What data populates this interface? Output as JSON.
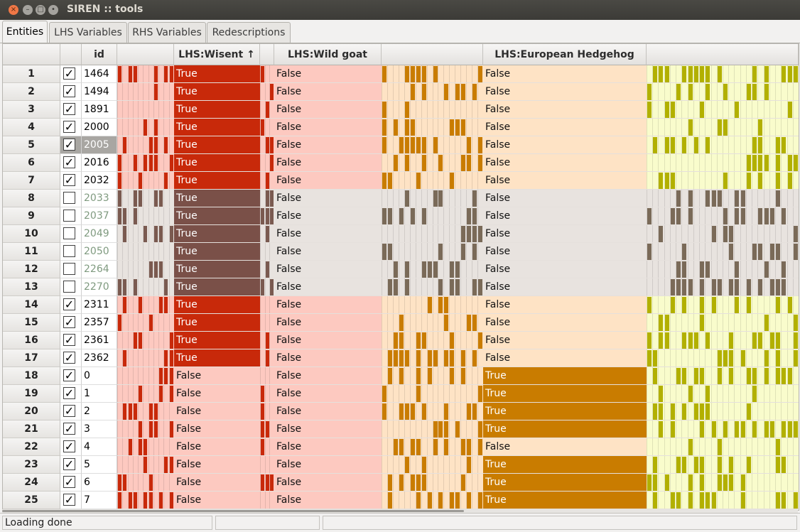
{
  "window": {
    "title": "SIREN :: tools"
  },
  "tabs": [
    {
      "label": "Entities",
      "active": true
    },
    {
      "label": "LHS Variables",
      "active": false
    },
    {
      "label": "RHS Variables",
      "active": false
    },
    {
      "label": "Redescriptions",
      "active": false
    }
  ],
  "grid": {
    "headers": {
      "id": "id",
      "col1": "LHS:Wisent ↑",
      "col2": "LHS:Wild goat",
      "col3": "LHS:European Hedgehog"
    },
    "rows": [
      {
        "n": "1",
        "checked": true,
        "id": "1464",
        "enabled": true,
        "c1": "True",
        "c2": "False",
        "c3": "False"
      },
      {
        "n": "2",
        "checked": true,
        "id": "1494",
        "enabled": true,
        "c1": "True",
        "c2": "False",
        "c3": "False"
      },
      {
        "n": "3",
        "checked": true,
        "id": "1891",
        "enabled": true,
        "c1": "True",
        "c2": "False",
        "c3": "False"
      },
      {
        "n": "4",
        "checked": true,
        "id": "2000",
        "enabled": true,
        "c1": "True",
        "c2": "False",
        "c3": "False"
      },
      {
        "n": "5",
        "checked": true,
        "id": "2005",
        "enabled": true,
        "c1": "True",
        "c2": "False",
        "c3": "False",
        "selected": true
      },
      {
        "n": "6",
        "checked": true,
        "id": "2016",
        "enabled": true,
        "c1": "True",
        "c2": "False",
        "c3": "False"
      },
      {
        "n": "7",
        "checked": true,
        "id": "2032",
        "enabled": true,
        "c1": "True",
        "c2": "False",
        "c3": "False"
      },
      {
        "n": "8",
        "checked": false,
        "id": "2033",
        "enabled": false,
        "c1": "True",
        "c2": "False",
        "c3": "False"
      },
      {
        "n": "9",
        "checked": false,
        "id": "2037",
        "enabled": false,
        "c1": "True",
        "c2": "False",
        "c3": "False"
      },
      {
        "n": "10",
        "checked": false,
        "id": "2049",
        "enabled": false,
        "c1": "True",
        "c2": "False",
        "c3": "False"
      },
      {
        "n": "11",
        "checked": false,
        "id": "2050",
        "enabled": false,
        "c1": "True",
        "c2": "False",
        "c3": "False"
      },
      {
        "n": "12",
        "checked": false,
        "id": "2264",
        "enabled": false,
        "c1": "True",
        "c2": "False",
        "c3": "False"
      },
      {
        "n": "13",
        "checked": false,
        "id": "2270",
        "enabled": false,
        "c1": "True",
        "c2": "False",
        "c3": "False"
      },
      {
        "n": "14",
        "checked": true,
        "id": "2311",
        "enabled": true,
        "c1": "True",
        "c2": "False",
        "c3": "False"
      },
      {
        "n": "15",
        "checked": true,
        "id": "2357",
        "enabled": true,
        "c1": "True",
        "c2": "False",
        "c3": "False"
      },
      {
        "n": "16",
        "checked": true,
        "id": "2361",
        "enabled": true,
        "c1": "True",
        "c2": "False",
        "c3": "False"
      },
      {
        "n": "17",
        "checked": true,
        "id": "2362",
        "enabled": true,
        "c1": "True",
        "c2": "False",
        "c3": "False"
      },
      {
        "n": "18",
        "checked": true,
        "id": "0",
        "enabled": true,
        "c1": "False",
        "c2": "False",
        "c3": "True"
      },
      {
        "n": "19",
        "checked": true,
        "id": "1",
        "enabled": true,
        "c1": "False",
        "c2": "False",
        "c3": "True"
      },
      {
        "n": "20",
        "checked": true,
        "id": "2",
        "enabled": true,
        "c1": "False",
        "c2": "False",
        "c3": "True"
      },
      {
        "n": "21",
        "checked": true,
        "id": "3",
        "enabled": true,
        "c1": "False",
        "c2": "False",
        "c3": "True"
      },
      {
        "n": "22",
        "checked": true,
        "id": "4",
        "enabled": true,
        "c1": "False",
        "c2": "False",
        "c3": "False"
      },
      {
        "n": "23",
        "checked": true,
        "id": "5",
        "enabled": true,
        "c1": "False",
        "c2": "False",
        "c3": "True"
      },
      {
        "n": "24",
        "checked": true,
        "id": "6",
        "enabled": true,
        "c1": "False",
        "c2": "False",
        "c3": "True"
      },
      {
        "n": "25",
        "checked": true,
        "id": "7",
        "enabled": true,
        "c1": "False",
        "c2": "False",
        "c3": "True"
      }
    ]
  },
  "colors": {
    "red_true": "#c8290a",
    "red_false": "#fdc9c0",
    "orange_true": "#c97c00",
    "orange_false": "#fee3c5",
    "yellow_false": "#f9fccc",
    "disabled_true": "#7a5048",
    "disabled_false": "#e8e3df"
  },
  "status": {
    "text": "Loading done"
  }
}
